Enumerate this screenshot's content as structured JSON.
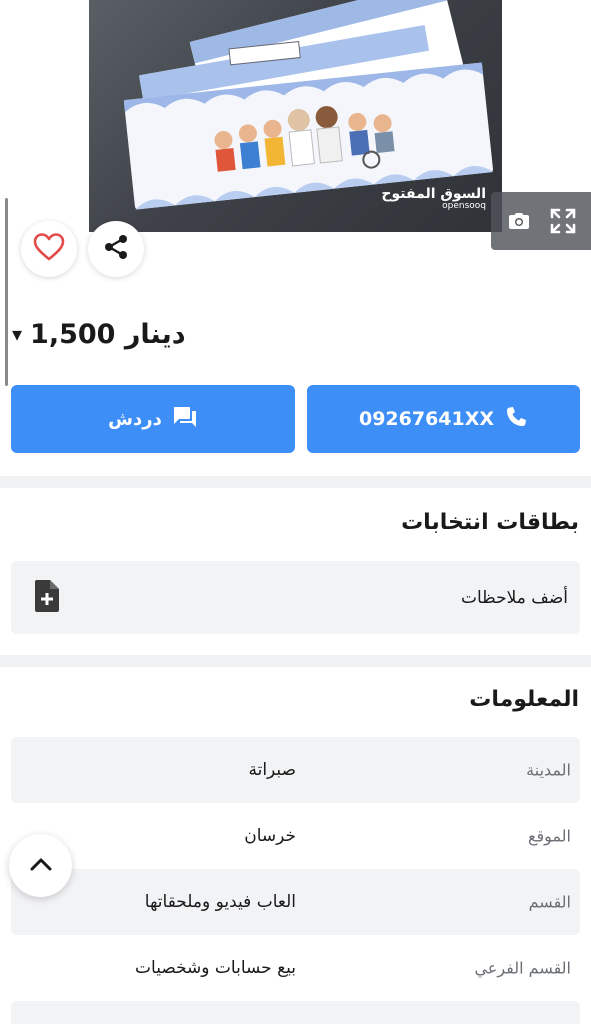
{
  "listing": {
    "photo": {
      "watermark_ar": "السوق المفتوح",
      "watermark_en": "opensooq"
    },
    "photo_controls": {
      "camera_icon": "camera-icon",
      "fullscreen_icon": "fullscreen-icon"
    },
    "favorite_icon": "heart-outline-icon",
    "share_icon": "share-icon",
    "price": {
      "amount": "1,500 دينار",
      "caret": "▾"
    },
    "actions": {
      "call_label": "09267641XX",
      "chat_label": "دردش"
    }
  },
  "elections": {
    "title": "بطاقات انتخابات",
    "add_notes_label": "أضف ملاحظات"
  },
  "info": {
    "title": "المعلومات",
    "rows": [
      {
        "key": "المدينة",
        "value": "صبراتة"
      },
      {
        "key": "الموقع",
        "value": "خرسان"
      },
      {
        "key": "القسم",
        "value": "العاب فيديو وملحقاتها"
      },
      {
        "key": "القسم الفرعي",
        "value": "بيع حسابات وشخصيات"
      }
    ]
  },
  "colors": {
    "accent": "#3e8ef7",
    "row_bg": "#f2f3f5",
    "heart": "#e34b4b"
  }
}
